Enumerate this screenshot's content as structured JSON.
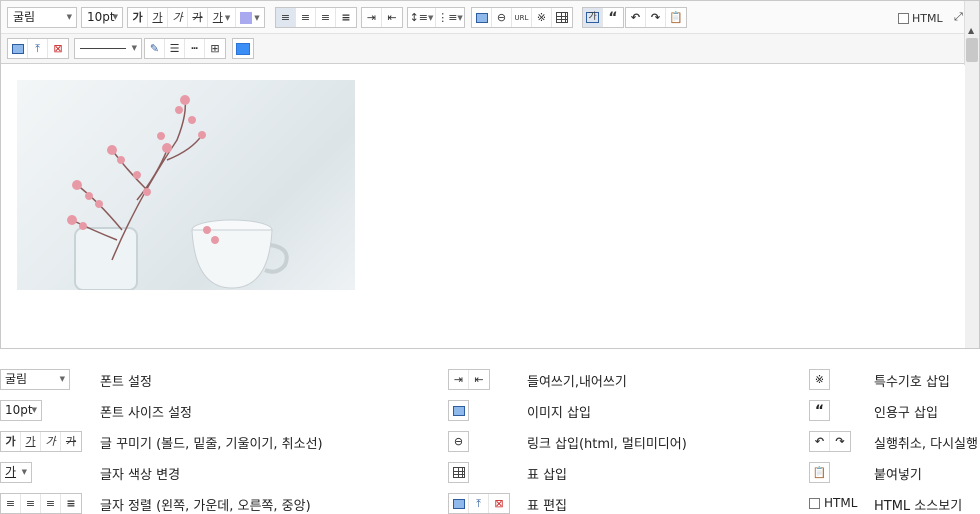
{
  "toolbar": {
    "font_select": "굴림",
    "size_select": "10pt",
    "style_buttons": [
      "가",
      "가",
      "가",
      "가"
    ],
    "color_button": "가",
    "html_toggle_label": "HTML",
    "url_label": "URL",
    "quote_label": "“"
  },
  "colors": {
    "highlight": "#a9a9ef",
    "active_button": "#dfe6f0",
    "border": "#c6c6c6"
  },
  "legend": {
    "col1": [
      {
        "control": "굴림",
        "label": "폰트 설정"
      },
      {
        "control": "10pt",
        "label": "폰트 사이즈 설정"
      },
      {
        "control": "가 가 가 가",
        "label": "글 꾸미기 (볼드, 밑줄, 기울이기, 취소선)"
      },
      {
        "control": "가",
        "label": "글자 색상 변경"
      },
      {
        "control": "",
        "label": "글자 정렬 (왼쪽, 가운데, 오른쪽, 중앙)"
      }
    ],
    "col2": [
      {
        "label": "들여쓰기,내어쓰기"
      },
      {
        "label": "이미지 삽입"
      },
      {
        "label": "링크 삽입(html, 멀티미디어)"
      },
      {
        "label": "표 삽입"
      },
      {
        "label": "표 편집"
      }
    ],
    "col3": [
      {
        "label": "특수기호 삽입"
      },
      {
        "label": "인용구 삽입"
      },
      {
        "label": "실행취소, 다시실행"
      },
      {
        "label": "붙여넣기"
      },
      {
        "control": "HTML",
        "label": "HTML 소스보기"
      }
    ]
  }
}
